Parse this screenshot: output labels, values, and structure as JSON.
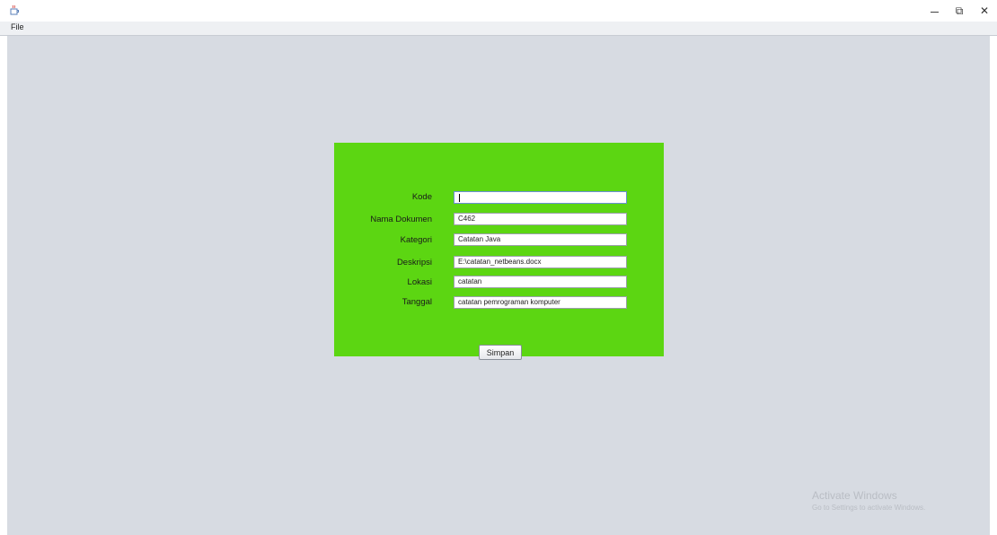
{
  "titlebar": {
    "app_icon": "java-cup-icon",
    "controls": {
      "minimize_icon": "minimize-icon",
      "restore_icon": "restore-icon",
      "close_icon": "close-icon",
      "restore_glyph": "⧉",
      "close_glyph": "✕"
    }
  },
  "menubar": {
    "file_label": "File"
  },
  "form": {
    "background": "#5cd612",
    "fields": {
      "kode": {
        "label": "Kode",
        "value": ""
      },
      "nama_dokumen": {
        "label": "Nama Dokumen",
        "value": "C462"
      },
      "kategori": {
        "label": "Kategori",
        "value": "Catatan Java"
      },
      "deskripsi": {
        "label": "Deskripsi",
        "value": "E:\\catatan_netbeans.docx"
      },
      "lokasi": {
        "label": "Lokasi",
        "value": "catatan"
      },
      "tanggal": {
        "label": "Tanggal",
        "value": "catatan pemrograman komputer"
      }
    },
    "save_label": "Simpan"
  },
  "watermark": {
    "title": "Activate Windows",
    "subtitle": "Go to Settings to activate Windows."
  }
}
